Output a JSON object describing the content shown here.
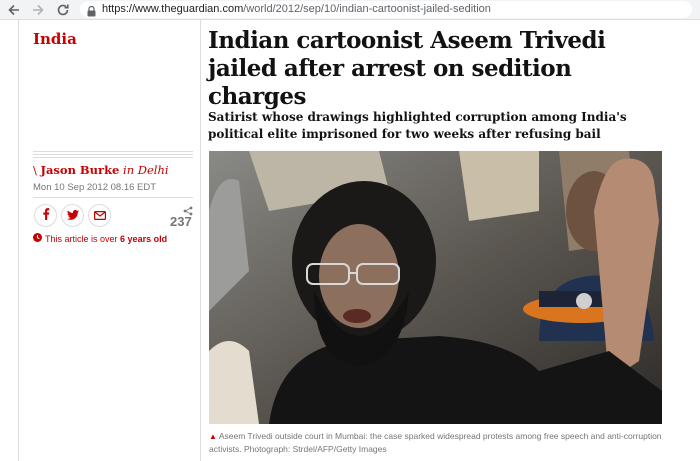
{
  "browser": {
    "url_host": "https://www.theguardian.com",
    "url_path": "/world/2012/sep/10/indian-cartoonist-jailed-sedition"
  },
  "article": {
    "section": "India",
    "headline": "Indian cartoonist Aseem Trivedi jailed after arrest on sedition charges",
    "standfirst": "Satirist whose drawings highlighted corruption among India's political elite imprisoned for two weeks after refusing bail",
    "byline_bar": "\\",
    "author": "Jason Burke",
    "location": "in Delhi",
    "date": "Mon 10 Sep 2012 08.16 EDT",
    "share_count": "237",
    "age_prefix": "This article is over",
    "age_value": "6 years old",
    "caption": "Aseem Trivedi outside court in Mumbai: the case sparked widespread protests among free speech and anti-corruption activists. Photograph: Strdel/AFP/Getty Images"
  },
  "colors": {
    "accent": "#c70000",
    "text": "#121212",
    "muted": "#767676"
  },
  "icons": [
    "back-arrow-icon",
    "forward-arrow-icon",
    "reload-icon",
    "lock-icon",
    "facebook-icon",
    "twitter-icon",
    "email-icon",
    "share-icon",
    "clock-icon",
    "caption-triangle-icon"
  ]
}
